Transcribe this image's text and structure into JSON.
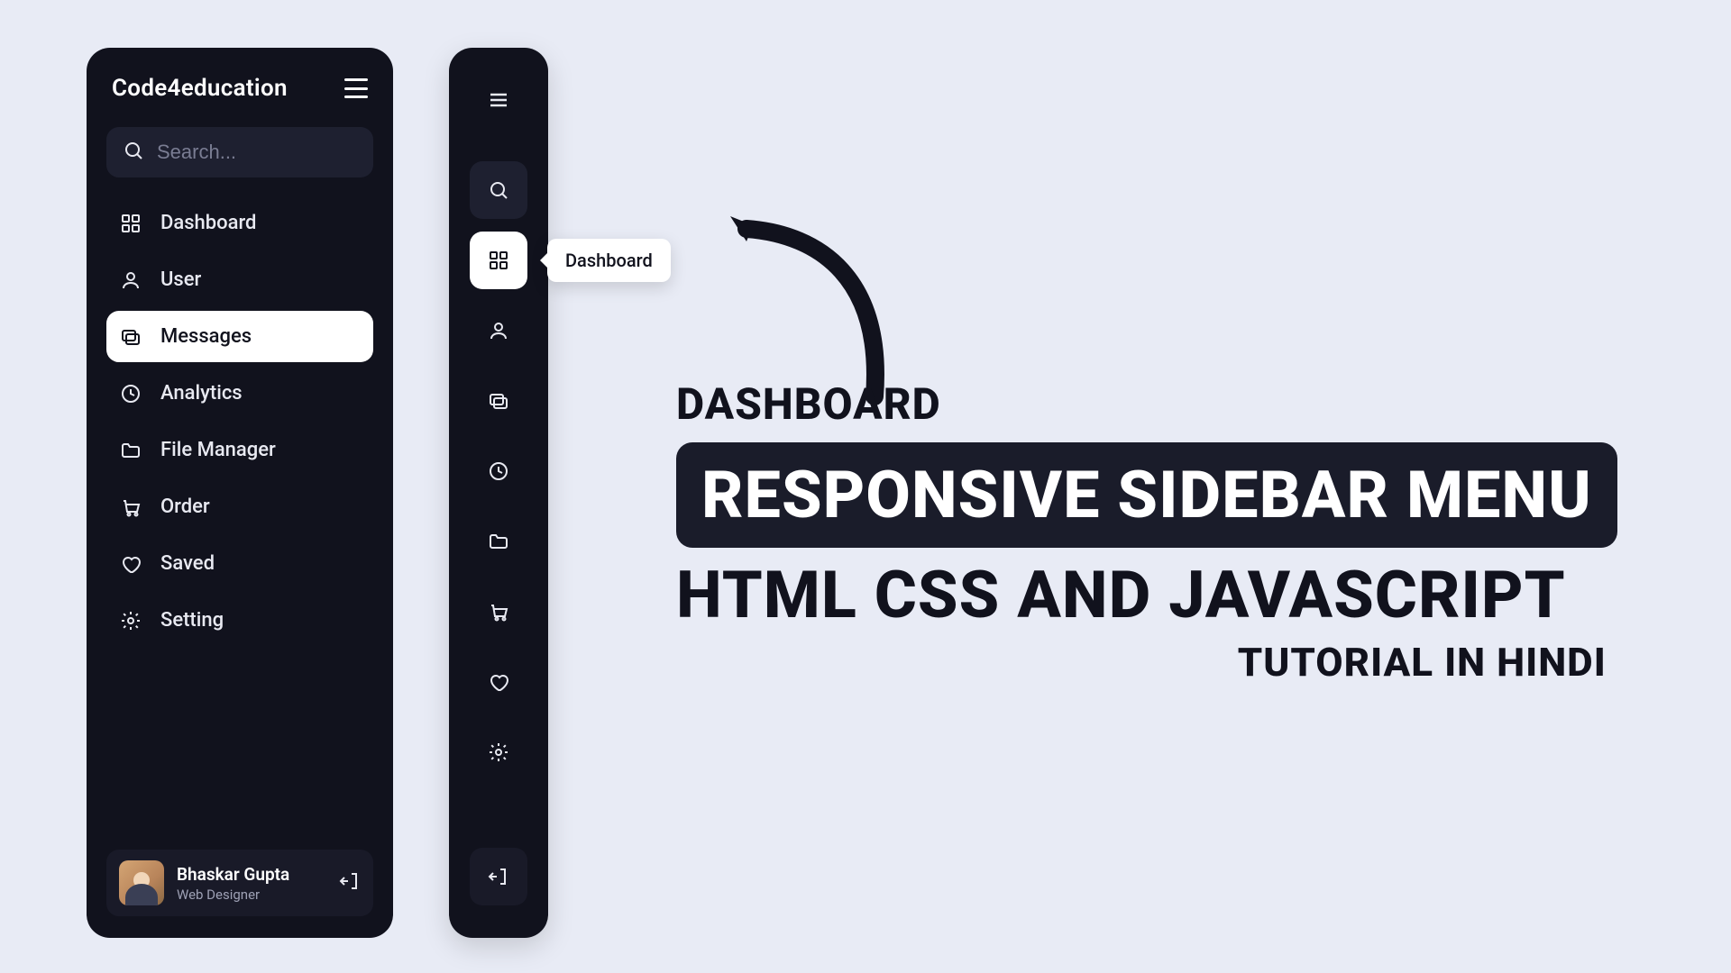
{
  "brand": "Code4education",
  "search": {
    "placeholder": "Search..."
  },
  "menu": [
    {
      "label": "Dashboard",
      "icon": "grid-icon",
      "active": false
    },
    {
      "label": "User",
      "icon": "user-icon",
      "active": false
    },
    {
      "label": "Messages",
      "icon": "messages-icon",
      "active": true
    },
    {
      "label": "Analytics",
      "icon": "clock-icon",
      "active": false
    },
    {
      "label": "File Manager",
      "icon": "folder-icon",
      "active": false
    },
    {
      "label": "Order",
      "icon": "cart-icon",
      "active": false
    },
    {
      "label": "Saved",
      "icon": "heart-icon",
      "active": false
    },
    {
      "label": "Setting",
      "icon": "gear-icon",
      "active": false
    }
  ],
  "profile": {
    "name": "Bhaskar Gupta",
    "role": "Web Designer"
  },
  "tooltip": "Dashboard",
  "headline": {
    "line1": "DASHBOARD",
    "line2": "RESPONSIVE SIDEBAR MENU",
    "line3": "HTML CSS AND JAVASCRIPT",
    "line4": "TUTORIAL IN HINDI"
  }
}
